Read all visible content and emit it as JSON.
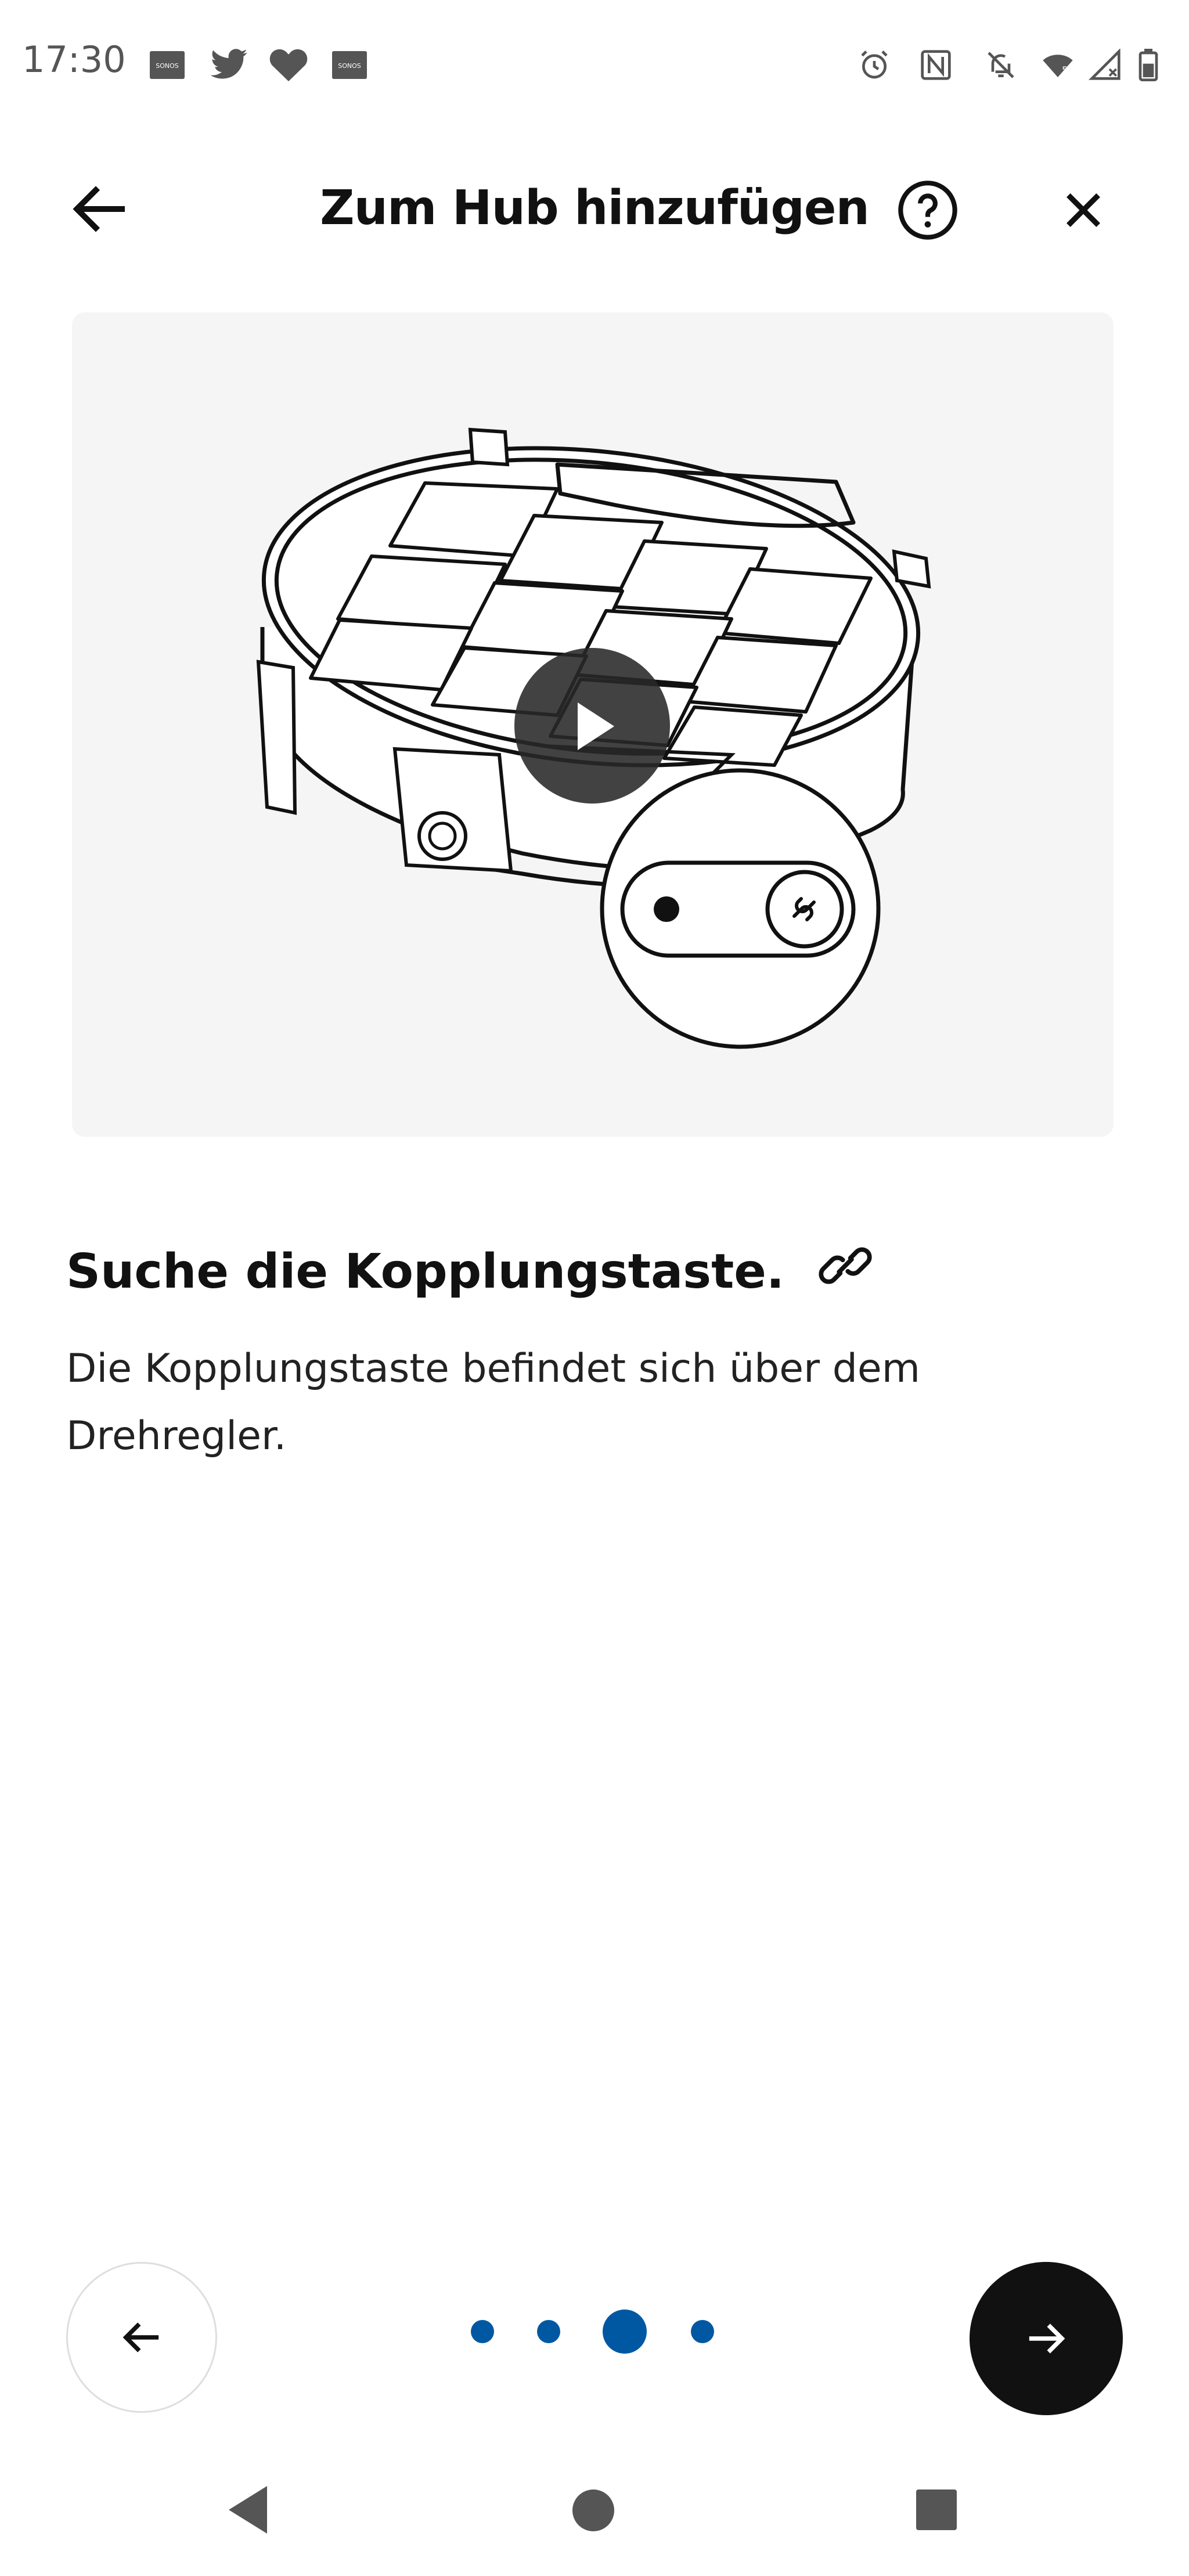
{
  "status_bar": {
    "time": "17:30",
    "left_icons": [
      "sonos-icon",
      "twitter-icon",
      "heart-icon",
      "sonos-icon"
    ],
    "right_icons": [
      "alarm-icon",
      "nfc-icon",
      "bell-off-icon",
      "wifi-icon",
      "signal-icon",
      "battery-icon"
    ]
  },
  "header": {
    "title": "Zum Hub hinzufügen",
    "back_icon": "arrow-left-icon",
    "help_icon": "help-circle-icon",
    "close_icon": "close-icon"
  },
  "media": {
    "play_icon": "play-icon",
    "illustration": "hub-device-pairing-button-illustration"
  },
  "step": {
    "heading": "Suche die Kopplungstaste.",
    "heading_icon": "link-icon",
    "body": "Die Kopplungstaste befindet sich über dem Drehregler."
  },
  "pager": {
    "total": 4,
    "current": 3
  },
  "colors": {
    "accent": "#0058a3",
    "card_bg": "#f5f5f5",
    "next_button": "#111111"
  },
  "system_nav": [
    "back-triangle-icon",
    "home-circle-icon",
    "recents-square-icon"
  ]
}
